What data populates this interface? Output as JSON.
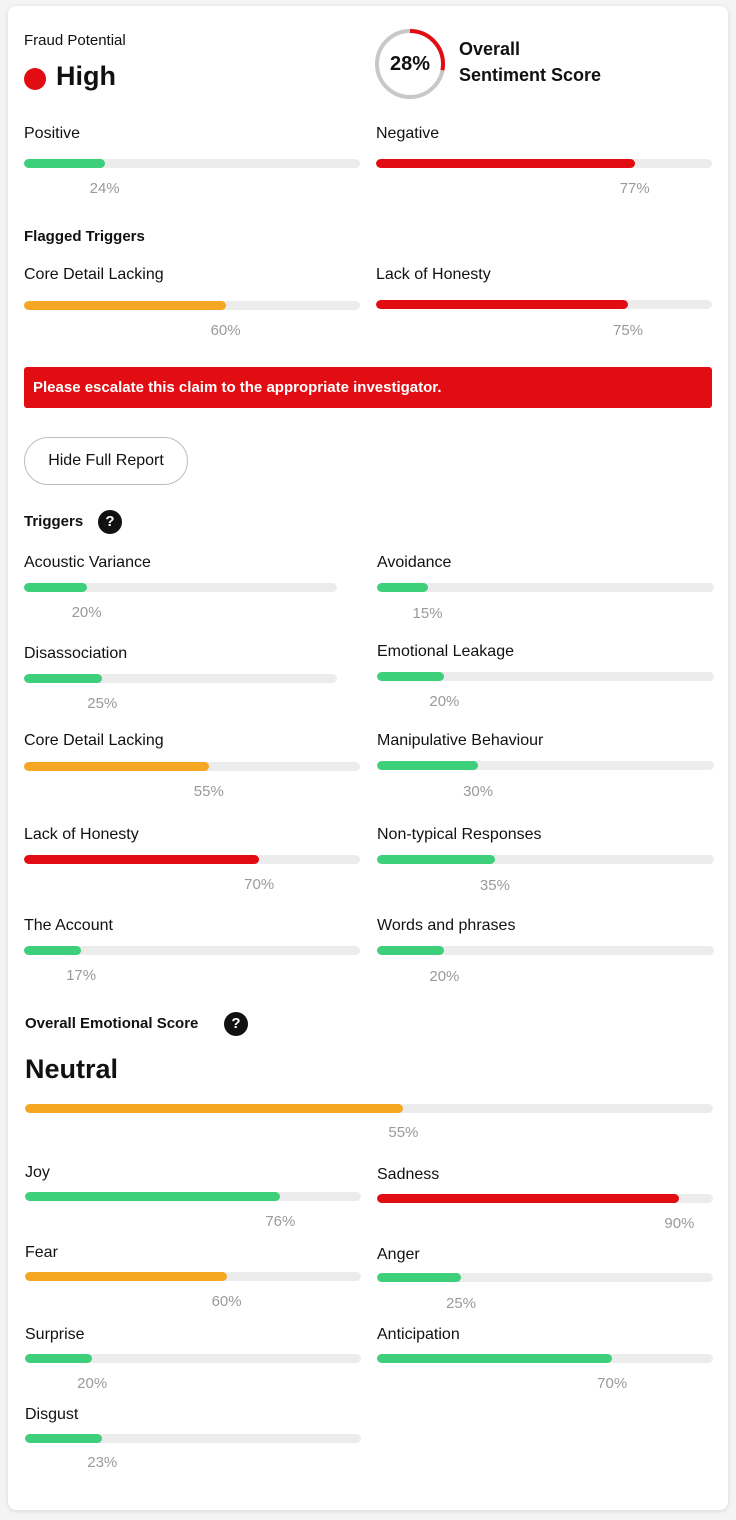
{
  "colors": {
    "green": "#3ecf7a",
    "red": "#e10d12",
    "orange": "#f5a623"
  },
  "fraud": {
    "label": "Fraud Potential",
    "level": "High",
    "level_color": "#e10d12"
  },
  "sentiment": {
    "score_text": "28%",
    "score": 28,
    "title_line1": "Overall",
    "title_line2": "Sentiment Score"
  },
  "summary": {
    "positive": {
      "label": "Positive",
      "value": 24,
      "text": "24%",
      "color": "green"
    },
    "negative": {
      "label": "Negative",
      "value": 77,
      "text": "77%",
      "color": "red"
    }
  },
  "flagged": {
    "title": "Flagged Triggers",
    "items": [
      {
        "label": "Core Detail Lacking",
        "value": 60,
        "text": "60%",
        "color": "orange"
      },
      {
        "label": "Lack of Honesty",
        "value": 75,
        "text": "75%",
        "color": "red"
      }
    ]
  },
  "banner": {
    "text": "Please escalate this claim to the appropriate investigator."
  },
  "report_button": {
    "label": "Hide Full Report"
  },
  "triggers": {
    "title": "Triggers",
    "help": "?",
    "items": [
      {
        "label": "Acoustic Variance",
        "value": 20,
        "text": "20%",
        "color": "green"
      },
      {
        "label": "Avoidance",
        "value": 15,
        "text": "15%",
        "color": "green"
      },
      {
        "label": "Disassociation",
        "value": 25,
        "text": "25%",
        "color": "green"
      },
      {
        "label": "Emotional Leakage",
        "value": 20,
        "text": "20%",
        "color": "green"
      },
      {
        "label": "Core Detail Lacking",
        "value": 55,
        "text": "55%",
        "color": "orange"
      },
      {
        "label": "Manipulative Behaviour",
        "value": 30,
        "text": "30%",
        "color": "green"
      },
      {
        "label": "Lack of Honesty",
        "value": 70,
        "text": "70%",
        "color": "red"
      },
      {
        "label": "Non-typical Responses",
        "value": 35,
        "text": "35%",
        "color": "green"
      },
      {
        "label": "The Account",
        "value": 17,
        "text": "17%",
        "color": "green"
      },
      {
        "label": "Words and phrases",
        "value": 20,
        "text": "20%",
        "color": "green"
      }
    ]
  },
  "emotional": {
    "title": "Overall Emotional Score",
    "help": "?",
    "verdict": "Neutral",
    "overall": {
      "value": 55,
      "text": "55%",
      "color": "orange"
    },
    "items": [
      {
        "label": "Joy",
        "value": 76,
        "text": "76%",
        "color": "green"
      },
      {
        "label": "Sadness",
        "value": 90,
        "text": "90%",
        "color": "red"
      },
      {
        "label": "Fear",
        "value": 60,
        "text": "60%",
        "color": "orange"
      },
      {
        "label": "Anger",
        "value": 25,
        "text": "25%",
        "color": "green"
      },
      {
        "label": "Surprise",
        "value": 20,
        "text": "20%",
        "color": "green"
      },
      {
        "label": "Anticipation",
        "value": 70,
        "text": "70%",
        "color": "green"
      },
      {
        "label": "Disgust",
        "value": 23,
        "text": "23%",
        "color": "green"
      }
    ]
  }
}
